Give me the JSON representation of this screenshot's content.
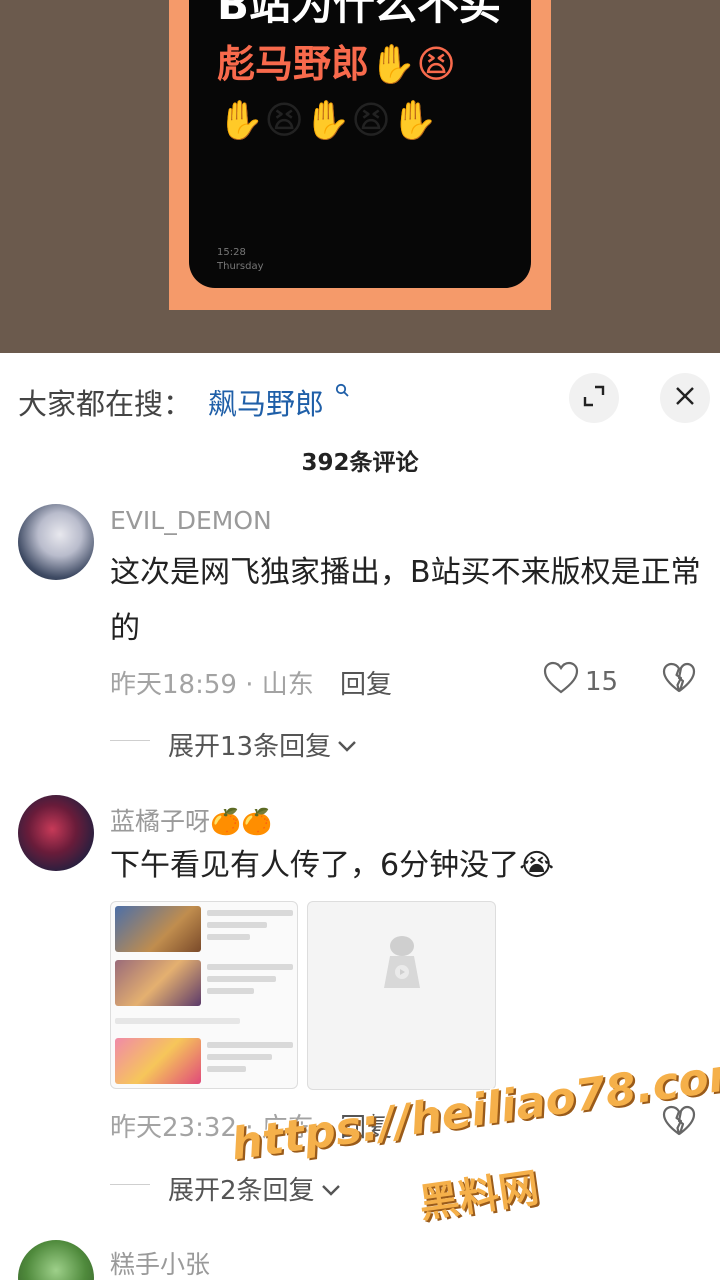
{
  "video": {
    "line1": "B站为什么不买",
    "line2": "彪马野郎✋😫",
    "line3": "✋😫✋😫✋",
    "time": "15:28",
    "day": "Thursday"
  },
  "search": {
    "prefix": "大家都在搜：",
    "keyword": "飙马野郎",
    "icon": "search-icon"
  },
  "header": {
    "expand_icon": "expand-icon",
    "close_icon": "close-icon"
  },
  "comment_count": "392条评论",
  "comments": [
    {
      "username": "EVIL_DEMON",
      "content": "这次是网飞独家播出，B站买不来版权是正常的",
      "time_location": "昨天18:59 · 山东",
      "reply_label": "回复",
      "likes": "15",
      "expand_label": "展开13条回复"
    },
    {
      "username": "蓝橘子呀🍊🍊",
      "content": "下午看见有人传了，6分钟没了😭",
      "time_location": "昨天23:32 · 广东",
      "reply_label": "回复",
      "likes": "",
      "expand_label": "展开2条回复"
    },
    {
      "username": "糕手小张"
    }
  ],
  "watermark": {
    "url": "https://heiliao78.com",
    "name": "黑料网"
  },
  "colors": {
    "keyword": "#1f5fa8",
    "video_frame": "#f59a6a",
    "video_red_text": "#f86a4c",
    "watermark": "#f5b04a"
  }
}
